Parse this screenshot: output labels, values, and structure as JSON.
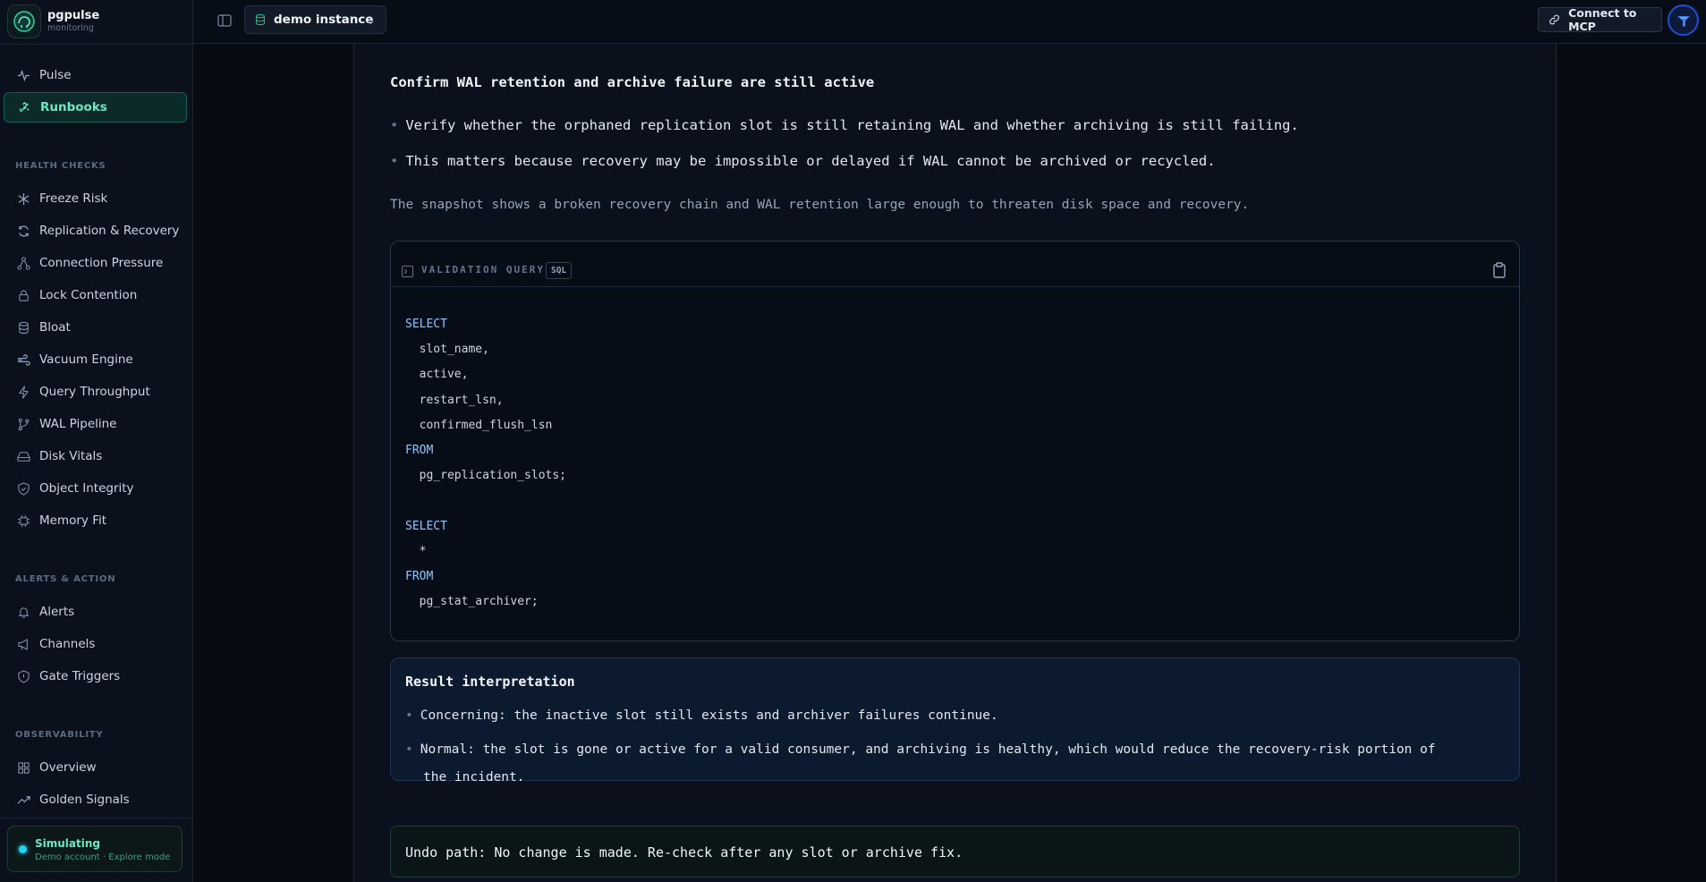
{
  "brand": {
    "name": "pgpulse",
    "subtitle": "monitoring"
  },
  "nav": {
    "top": [
      {
        "label": "Pulse",
        "icon": "pulse-icon"
      },
      {
        "label": "Runbooks",
        "icon": "runbooks-icon",
        "active": true
      }
    ],
    "health_checks_label": "HEALTH CHECKS",
    "health_checks": [
      {
        "label": "Freeze Risk",
        "icon": "snowflake-icon"
      },
      {
        "label": "Replication & Recovery",
        "icon": "refresh-icon"
      },
      {
        "label": "Connection Pressure",
        "icon": "network-icon"
      },
      {
        "label": "Lock Contention",
        "icon": "lock-icon"
      },
      {
        "label": "Bloat",
        "icon": "database-icon"
      },
      {
        "label": "Vacuum Engine",
        "icon": "wind-icon"
      },
      {
        "label": "Query Throughput",
        "icon": "zap-icon"
      },
      {
        "label": "WAL Pipeline",
        "icon": "git-branch-icon"
      },
      {
        "label": "Disk Vitals",
        "icon": "hard-drive-icon"
      },
      {
        "label": "Object Integrity",
        "icon": "shield-check-icon"
      },
      {
        "label": "Memory Fit",
        "icon": "cpu-icon"
      }
    ],
    "alerts_label": "ALERTS & ACTION",
    "alerts": [
      {
        "label": "Alerts",
        "icon": "bell-icon"
      },
      {
        "label": "Channels",
        "icon": "megaphone-icon"
      },
      {
        "label": "Gate Triggers",
        "icon": "shield-icon"
      }
    ],
    "observability_label": "OBSERVABILITY",
    "observability": [
      {
        "label": "Overview",
        "icon": "grid-icon"
      },
      {
        "label": "Golden Signals",
        "icon": "trending-up-icon"
      }
    ]
  },
  "simulation": {
    "title": "Simulating",
    "subtitle": "Demo account · Explore mode"
  },
  "topbar": {
    "instance": "demo instance",
    "connect_label": "Connect to MCP"
  },
  "step": {
    "title": "Confirm WAL retention and archive failure are still active",
    "bullets": [
      "Verify whether the orphaned replication slot is still retaining WAL and whether archiving is still failing.",
      "This matters because recovery may be impossible or delayed if WAL cannot be archived or recycled."
    ],
    "note": "The snapshot shows a broken recovery chain and WAL retention large enough to threaten disk space and recovery."
  },
  "query": {
    "label": "VALIDATION QUERY",
    "badge": "SQL",
    "lines": [
      {
        "text": "SELECT",
        "kind": "kw"
      },
      {
        "text": "  slot_name,",
        "kind": "id"
      },
      {
        "text": "  active,",
        "kind": "id"
      },
      {
        "text": "  restart_lsn,",
        "kind": "id"
      },
      {
        "text": "  confirmed_flush_lsn",
        "kind": "id"
      },
      {
        "text": "FROM",
        "kind": "kw"
      },
      {
        "text": "  pg_replication_slots;",
        "kind": "id"
      },
      {
        "text": "",
        "kind": "id"
      },
      {
        "text": "SELECT",
        "kind": "kw"
      },
      {
        "text": "  *",
        "kind": "id"
      },
      {
        "text": "FROM",
        "kind": "kw"
      },
      {
        "text": "  pg_stat_archiver;",
        "kind": "id"
      }
    ]
  },
  "interpretation": {
    "title": "Result interpretation",
    "items": [
      "Concerning: the inactive slot still exists and archiver failures continue.",
      "Normal: the slot is gone or active for a valid consumer, and archiving is healthy, which would reduce the recovery-risk portion of",
      "the incident."
    ]
  },
  "undo": "Undo path: No change is made. Re-check after any slot or archive fix."
}
